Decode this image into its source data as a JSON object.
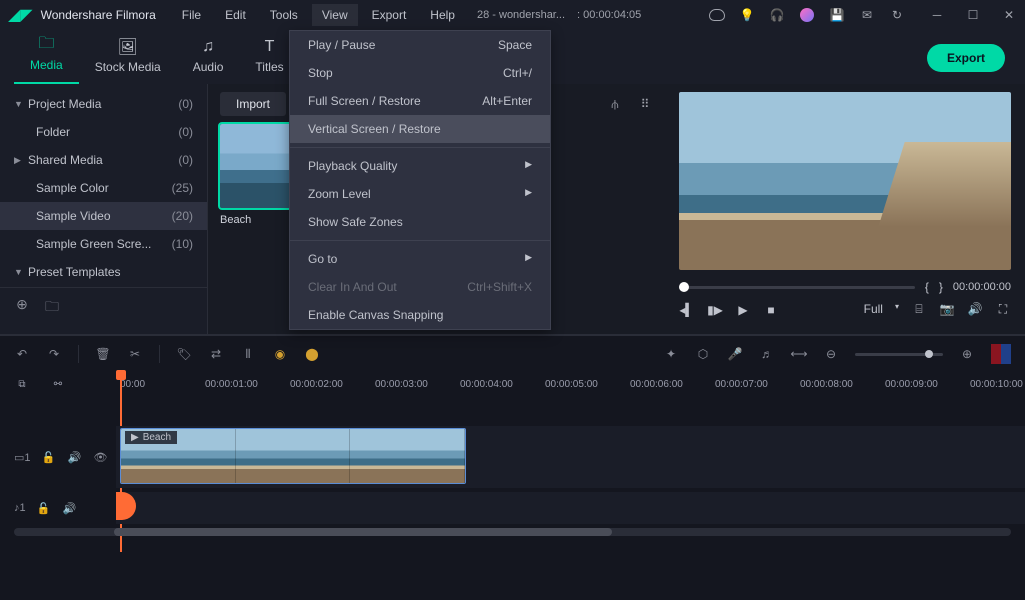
{
  "app": {
    "title": "Wondershare Filmora"
  },
  "menu": {
    "file": "File",
    "edit": "Edit",
    "tools": "Tools",
    "view": "View",
    "export": "Export",
    "help": "Help"
  },
  "project": {
    "name": "28 - wondershar...",
    "time": ": 00:00:04:05"
  },
  "tabs": {
    "media": "Media",
    "stock": "Stock Media",
    "audio": "Audio",
    "titles": "Titles"
  },
  "export_btn": "Export",
  "sidebar": {
    "project_media": {
      "label": "Project Media",
      "count": "(0)"
    },
    "folder": {
      "label": "Folder",
      "count": "(0)"
    },
    "shared_media": {
      "label": "Shared Media",
      "count": "(0)"
    },
    "sample_color": {
      "label": "Sample Color",
      "count": "(25)"
    },
    "sample_video": {
      "label": "Sample Video",
      "count": "(20)"
    },
    "sample_green": {
      "label": "Sample Green Scre...",
      "count": "(10)"
    },
    "preset_templates": {
      "label": "Preset Templates"
    }
  },
  "media": {
    "import": "Import",
    "thumb1": "Beach"
  },
  "view_menu": {
    "play_pause": {
      "label": "Play / Pause",
      "shortcut": "Space"
    },
    "stop": {
      "label": "Stop",
      "shortcut": "Ctrl+/"
    },
    "fullscreen": {
      "label": "Full Screen / Restore",
      "shortcut": "Alt+Enter"
    },
    "vertical": {
      "label": "Vertical Screen / Restore"
    },
    "playback_quality": {
      "label": "Playback Quality"
    },
    "zoom_level": {
      "label": "Zoom Level"
    },
    "safe_zones": {
      "label": "Show Safe Zones"
    },
    "goto": {
      "label": "Go to"
    },
    "clear_inout": {
      "label": "Clear In And Out",
      "shortcut": "Ctrl+Shift+X"
    },
    "canvas_snap": {
      "label": "Enable Canvas Snapping"
    }
  },
  "preview": {
    "bracket_open": "{",
    "bracket_close": "}",
    "time": "00:00:00:00",
    "fullscreen_label": "Full"
  },
  "ruler": [
    "00:00",
    "00:00:01:00",
    "00:00:02:00",
    "00:00:03:00",
    "00:00:04:00",
    "00:00:05:00",
    "00:00:06:00",
    "00:00:07:00",
    "00:00:08:00",
    "00:00:09:00",
    "00:00:10:00"
  ],
  "tracks": {
    "video": {
      "id": "1",
      "clip_label": "Beach"
    },
    "audio": {
      "id": "1"
    }
  }
}
